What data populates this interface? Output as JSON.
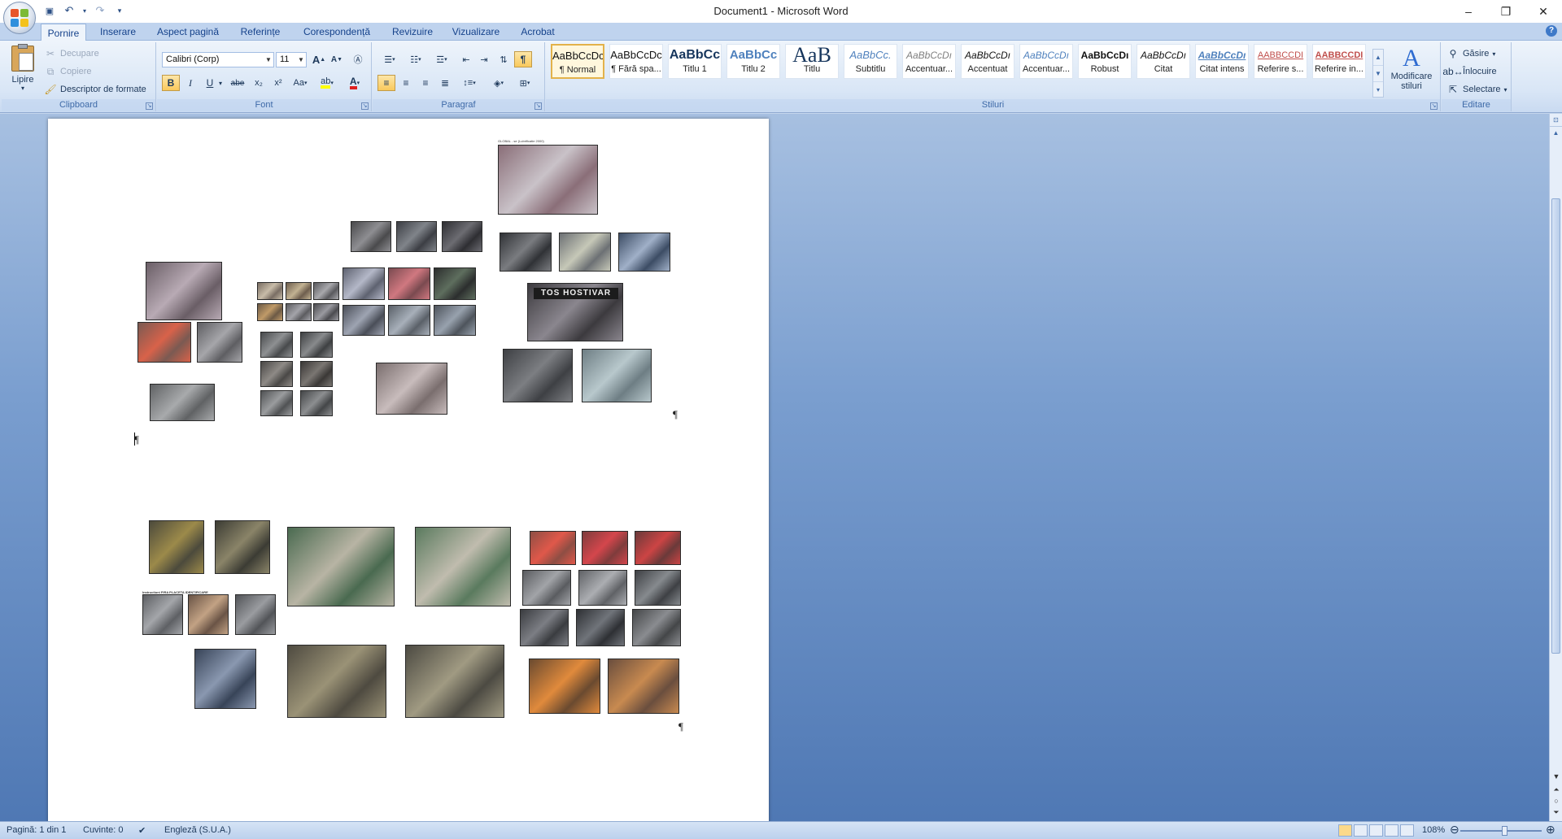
{
  "window": {
    "title": "Document1 - Microsoft Word",
    "controls": {
      "minimize": "–",
      "maximize": "❐",
      "close": "✕"
    }
  },
  "qat": {
    "save": "💾",
    "undo": "↶",
    "redo": "↷",
    "customize": "▾"
  },
  "tabs": [
    "Pornire",
    "Inserare",
    "Aspect pagină",
    "Referințe",
    "Corespondență",
    "Revizuire",
    "Vizualizare",
    "Acrobat"
  ],
  "active_tab": "Pornire",
  "clipboard": {
    "paste": "Lipire",
    "cut": "Decupare",
    "copy": "Copiere",
    "format_painter": "Descriptor de formate",
    "label": "Clipboard"
  },
  "font": {
    "name": "Calibri (Corp)",
    "size": "11",
    "label": "Font",
    "grow": "A",
    "shrink": "A",
    "bold": "B",
    "italic": "I",
    "underline": "U",
    "strike": "abe",
    "subscript": "x₂",
    "superscript": "x²",
    "change_case": "Aa"
  },
  "paragraph": {
    "label": "Paragraf",
    "show_marks": "¶"
  },
  "styles": {
    "label": "Stiluri",
    "items": [
      {
        "sample": "AaBbCcDc",
        "name": "¶ Normal"
      },
      {
        "sample": "AaBbCcDc",
        "name": "¶ Fără spa..."
      },
      {
        "sample": "AaBbCc",
        "name": "Titlu 1"
      },
      {
        "sample": "AaBbCc",
        "name": "Titlu 2"
      },
      {
        "sample": "AaB",
        "name": "Titlu"
      },
      {
        "sample": "AaBbCc.",
        "name": "Subtitlu"
      },
      {
        "sample": "AaBbCcDı",
        "name": "Accentuar..."
      },
      {
        "sample": "AaBbCcDı",
        "name": "Accentuat"
      },
      {
        "sample": "AaBbCcDı",
        "name": "Accentuar..."
      },
      {
        "sample": "AaBbCcDı",
        "name": "Robust"
      },
      {
        "sample": "AaBbCcDı",
        "name": "Citat"
      },
      {
        "sample": "AaBbCcDı",
        "name": "Citat intens"
      },
      {
        "sample": "AABBCCDI",
        "name": "Referire s..."
      },
      {
        "sample": "AABBCCDI",
        "name": "Referire in..."
      }
    ],
    "change_styles": "Modificare stiluri"
  },
  "editing": {
    "label": "Editare",
    "find": "Găsire",
    "replace": "Înlocuire",
    "select": "Selectare"
  },
  "status": {
    "page": "Pagină: 1 din 1",
    "words": "Cuvinte: 0",
    "language": "Engleză (S.U.A.)",
    "zoom": "108%"
  },
  "document": {
    "photo_captions": {
      "tos_plate": "TOS HOSTIVAR",
      "tiny_header": "GLOBAL - se (Lubrificatie 2000)",
      "caption_small": "Instructiuni FIRA PLACETA IDENTIFICARE"
    },
    "pilcrow": "¶"
  }
}
